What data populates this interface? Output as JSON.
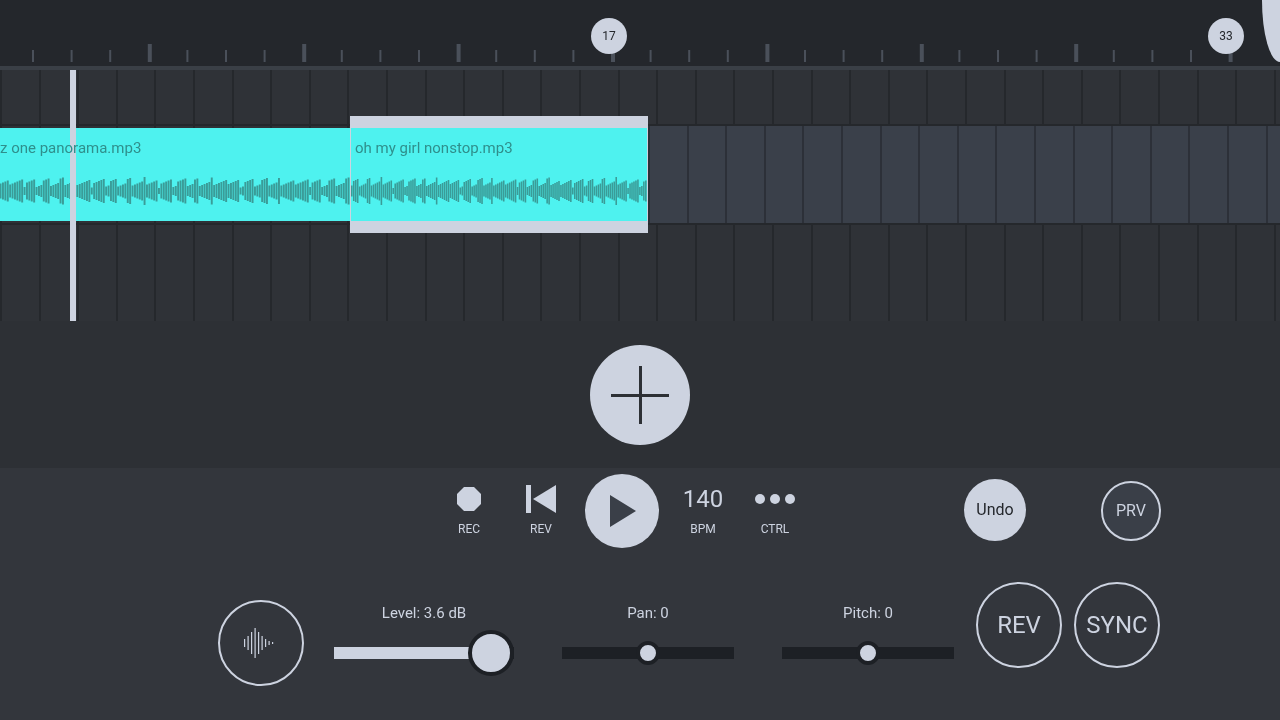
{
  "timeline": {
    "markers": [
      "17",
      "33"
    ]
  },
  "clips": [
    {
      "name": "z one panorama.mp3",
      "selected": false
    },
    {
      "name": "oh my girl nonstop.mp3",
      "selected": true
    }
  ],
  "transport": [
    {
      "kind": "record",
      "label": "REC"
    },
    {
      "kind": "rewind",
      "label": "REV"
    },
    {
      "kind": "play"
    },
    {
      "kind": "value",
      "value": "140",
      "label": "BPM"
    },
    {
      "kind": "more",
      "label": "CTRL"
    }
  ],
  "undo": "Undo",
  "prv": "PRV",
  "sliders": [
    {
      "kind": "fill",
      "label": "Level: 3.6 dB",
      "level": 0.88
    },
    {
      "kind": "center",
      "label": "Pan: 0",
      "level": 0.5
    },
    {
      "kind": "center",
      "label": "Pitch: 0",
      "level": 0.5
    }
  ],
  "buttons": [
    "REV",
    "SYNC"
  ]
}
